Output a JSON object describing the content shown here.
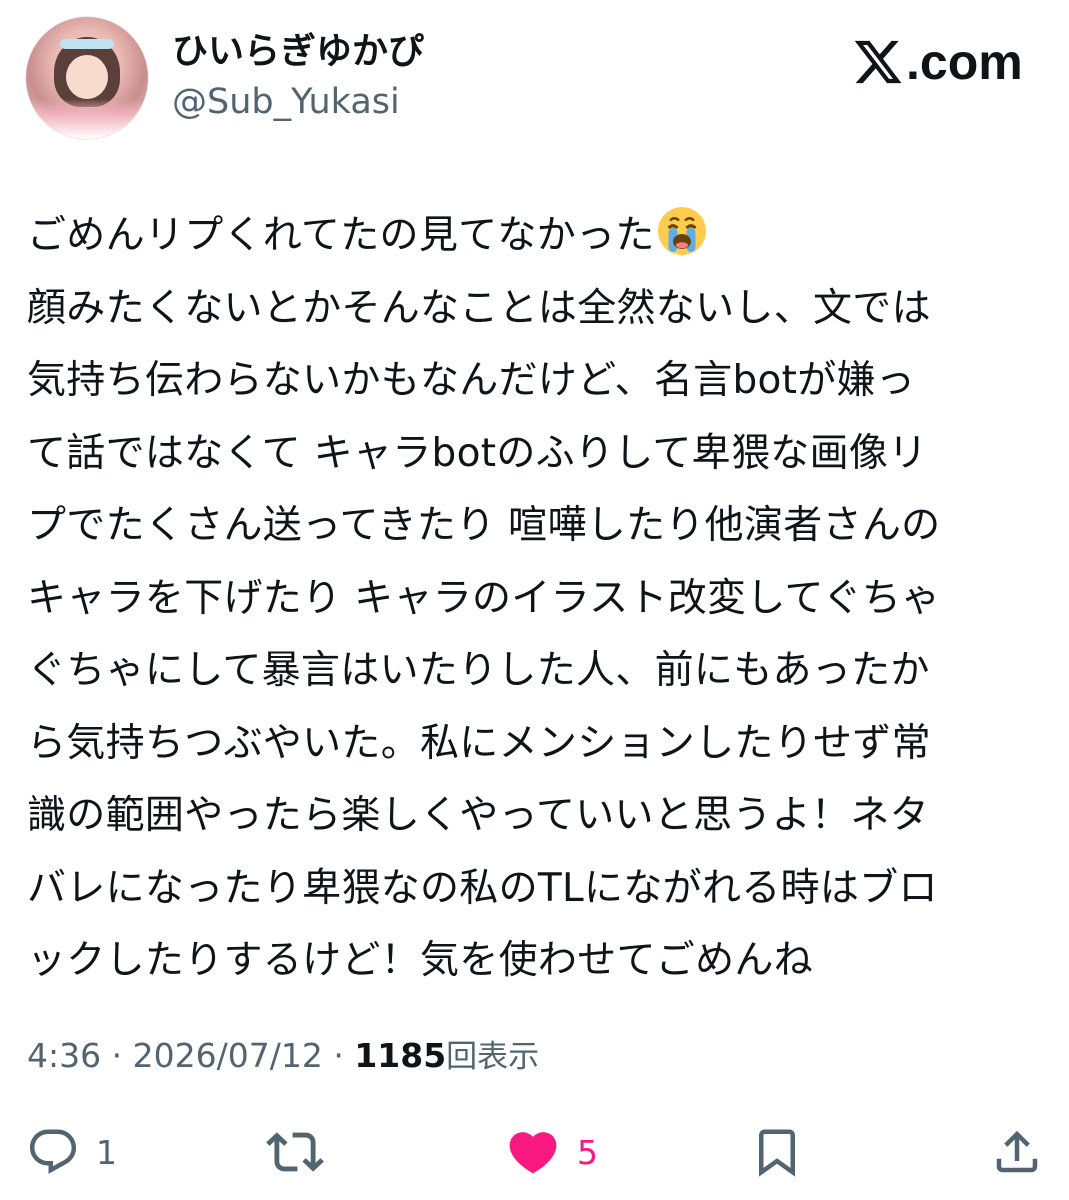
{
  "author": {
    "display_name": "ひいらぎゆかぴ",
    "handle": "@Sub_Yukasi"
  },
  "brand": {
    "text": ".com",
    "icon": "x-logo-icon"
  },
  "tweet": {
    "lines": [
      "ごめんリプくれてたの見てなかった",
      "顔みたくないとかそんなことは全然ないし、文では",
      "気持ち伝わらないかもなんだけど、名言botが嫌っ",
      "て話ではなくて キャラbotのふりして卑猥な画像リ",
      "プでたくさん送ってきたり 喧嘩したり他演者さんの",
      "キャラを下げたり キャラのイラスト改変してぐちゃ",
      "ぐちゃにして暴言はいたりした人、前にもあったか",
      "ら気持ちつぶやいた。私にメンションしたりせず常",
      "識の範囲やったら楽しくやっていいと思うよ！ネタ",
      "バレになったり卑猥なの私のTLにながれる時はブロ",
      "ックしたりするけど！気を使わせてごめんね"
    ],
    "emoji": "crying-face-icon"
  },
  "meta": {
    "time": "4:36",
    "date": "2026/07/12",
    "separator": "·",
    "views": "1185",
    "views_label": "回表示"
  },
  "actions": {
    "reply_count": "1",
    "retweet_count": "",
    "like_count": "5"
  },
  "colors": {
    "text": "#0f1419",
    "secondary": "#536471",
    "like": "#f91880"
  }
}
